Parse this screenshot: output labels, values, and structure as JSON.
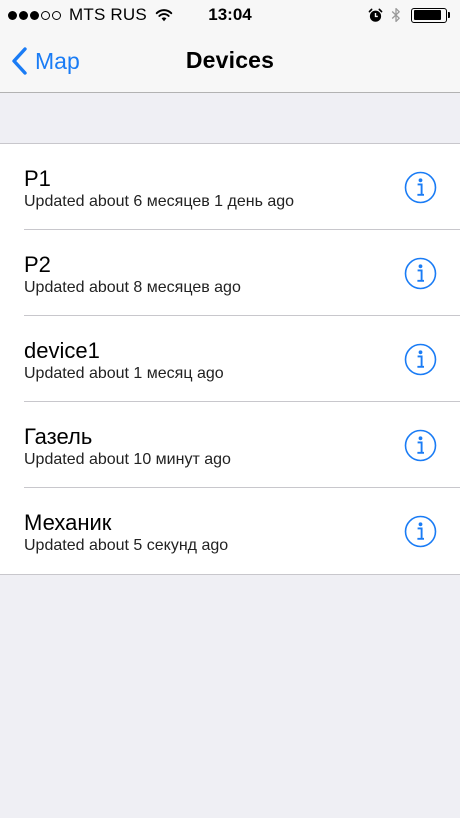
{
  "status_bar": {
    "signal_total": 5,
    "signal_filled": 3,
    "carrier": "MTS RUS",
    "time": "13:04",
    "battery_level": 0.9
  },
  "nav": {
    "back_label": "Map",
    "title": "Devices"
  },
  "devices": [
    {
      "name": "P1",
      "updated": "Updated about 6 месяцев 1 день ago"
    },
    {
      "name": "P2",
      "updated": "Updated about 8 месяцев ago"
    },
    {
      "name": "device1",
      "updated": "Updated about 1 месяц ago"
    },
    {
      "name": "Газель",
      "updated": "Updated about 10 минут ago"
    },
    {
      "name": "Механик",
      "updated": "Updated about 5 секунд ago"
    }
  ],
  "icons": {
    "back": "chevron-left-icon",
    "info": "info-circle-icon",
    "wifi": "wifi-icon",
    "alarm": "alarm-clock-icon",
    "bluetooth": "bluetooth-icon",
    "battery": "battery-icon"
  },
  "colors": {
    "accent": "#1a7cf5",
    "background": "#efeff4",
    "bar": "#f7f7f7",
    "separator": "#c8c7cc"
  }
}
